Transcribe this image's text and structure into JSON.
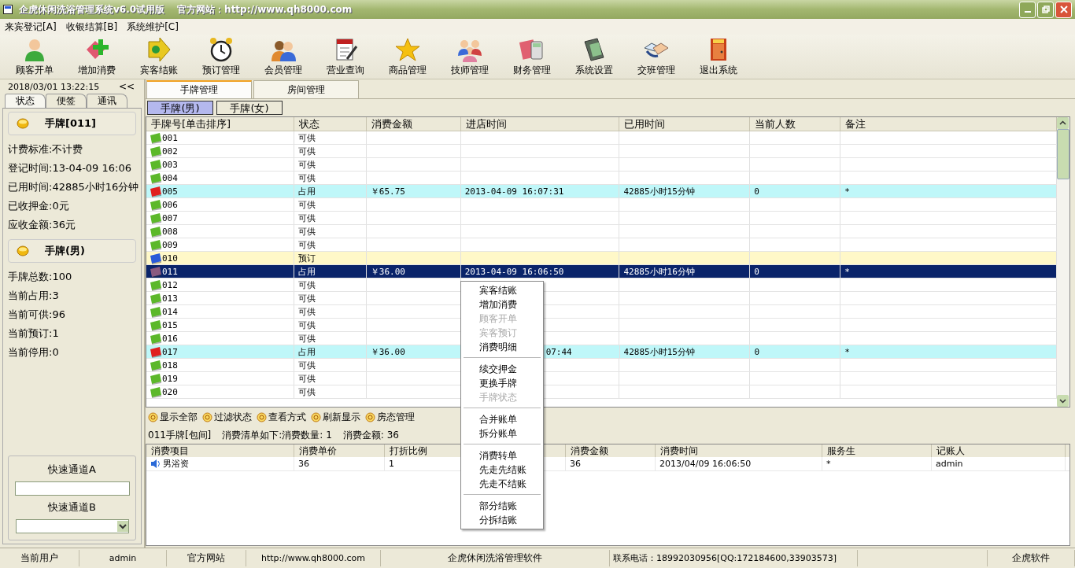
{
  "window": {
    "title": "企虎休闲洗浴管理系统v6.0试用版",
    "website_label": "官方网站：http://www.qh8000.com"
  },
  "menu_bar": [
    "来宾登记[A]",
    "收银结算[B]",
    "系统维护[C]"
  ],
  "toolbar": [
    "顾客开单",
    "增加消费",
    "宾客结账",
    "预订管理",
    "会员管理",
    "营业查询",
    "商品管理",
    "技师管理",
    "财务管理",
    "系统设置",
    "交班管理",
    "退出系统"
  ],
  "sidebar": {
    "datetime": "2018/03/01 13:22:15",
    "collapse": "<<",
    "tabs": [
      {
        "label": "状态",
        "selected": true
      },
      {
        "label": "便签",
        "selected": false
      },
      {
        "label": "通讯",
        "selected": false
      }
    ],
    "sections": [
      {
        "title": "手牌[011]",
        "lines": [
          "计费标准:不计费",
          "登记时间:13-04-09 16:06",
          "已用时间:42885小时16分钟",
          "已收押金:0元",
          "应收金额:36元"
        ]
      },
      {
        "title": "手牌(男)",
        "lines": [
          "手牌总数:100",
          "当前占用:3",
          "当前可供:96",
          "当前预订:1",
          "当前停用:0"
        ]
      }
    ],
    "quick_a": "快速通道A",
    "quick_b": "快速通道B"
  },
  "tabs": [
    {
      "label": "手牌管理",
      "selected": true
    },
    {
      "label": "房间管理",
      "selected": false
    }
  ],
  "sub_tabs": [
    {
      "label": "手牌(男)",
      "selected": true
    },
    {
      "label": "手牌(女)",
      "selected": false
    }
  ],
  "table": {
    "columns": [
      "手牌号[单击排序]",
      "状态",
      "消费金额",
      "进店时间",
      "已用时间",
      "当前人数",
      "备注"
    ],
    "rows": [
      {
        "no": "001",
        "status": "可供",
        "kind": "available",
        "selected": false
      },
      {
        "no": "002",
        "status": "可供",
        "kind": "available",
        "selected": false
      },
      {
        "no": "003",
        "status": "可供",
        "kind": "available",
        "selected": false
      },
      {
        "no": "004",
        "status": "可供",
        "kind": "available",
        "selected": false
      },
      {
        "no": "005",
        "status": "占用",
        "kind": "occupied",
        "selected": false,
        "amount": "￥65.75",
        "entry_time": "2013-04-09 16:07:31",
        "used_time": "42885小时15分钟",
        "people": "0",
        "note": "*"
      },
      {
        "no": "006",
        "status": "可供",
        "kind": "available",
        "selected": false
      },
      {
        "no": "007",
        "status": "可供",
        "kind": "available",
        "selected": false
      },
      {
        "no": "008",
        "status": "可供",
        "kind": "available",
        "selected": false
      },
      {
        "no": "009",
        "status": "可供",
        "kind": "available",
        "selected": false
      },
      {
        "no": "010",
        "status": "预订",
        "kind": "reserved",
        "selected": false
      },
      {
        "no": "011",
        "status": "占用",
        "kind": "occupied",
        "selected": true,
        "amount": "￥36.00",
        "entry_time": "2013-04-09 16:06:50",
        "used_time": "42885小时16分钟",
        "people": "0",
        "note": "*"
      },
      {
        "no": "012",
        "status": "可供",
        "kind": "available",
        "selected": false
      },
      {
        "no": "013",
        "status": "可供",
        "kind": "available",
        "selected": false
      },
      {
        "no": "014",
        "status": "可供",
        "kind": "available",
        "selected": false
      },
      {
        "no": "015",
        "status": "可供",
        "kind": "available",
        "selected": false
      },
      {
        "no": "016",
        "status": "可供",
        "kind": "available",
        "selected": false
      },
      {
        "no": "017",
        "status": "占用",
        "kind": "occupied",
        "selected": false,
        "amount": "￥36.00",
        "entry_time": "07:44",
        "entry_time_partly_hidden": true,
        "used_time": "42885小时15分钟",
        "people": "0",
        "note": "*"
      },
      {
        "no": "018",
        "status": "可供",
        "kind": "available",
        "selected": false
      },
      {
        "no": "019",
        "status": "可供",
        "kind": "available",
        "selected": false
      },
      {
        "no": "020",
        "status": "可供",
        "kind": "available",
        "selected": false
      }
    ]
  },
  "actions": [
    "显示全部",
    "过滤状态",
    "查看方式",
    "刷新显示",
    "房态管理"
  ],
  "summary": [
    "011手牌[包间]",
    "消费清单如下:消费数量: 1",
    "消费金额: 36"
  ],
  "detail": {
    "columns": [
      "消费项目",
      "消费单价",
      "打折比例",
      "",
      "消费金额",
      "消费时间",
      "服务生",
      "记账人"
    ],
    "rows": [
      [
        "男浴资",
        "36",
        "1",
        "",
        "36",
        "2013/04/09 16:06:50",
        "*",
        "admin"
      ]
    ]
  },
  "context_menu": [
    [
      {
        "label": "宾客结账",
        "disabled": false
      },
      {
        "label": "增加消费",
        "disabled": false
      },
      {
        "label": "顾客开单",
        "disabled": true
      },
      {
        "label": "宾客预订",
        "disabled": true
      },
      {
        "label": "消费明细",
        "disabled": false
      }
    ],
    [
      {
        "label": "续交押金",
        "disabled": false
      },
      {
        "label": "更换手牌",
        "disabled": false
      },
      {
        "label": "手牌状态",
        "disabled": true
      }
    ],
    [
      {
        "label": "合并账单",
        "disabled": false
      },
      {
        "label": "拆分账单",
        "disabled": false
      }
    ],
    [
      {
        "label": "消费转单",
        "disabled": false
      },
      {
        "label": "先走先结账",
        "disabled": false
      },
      {
        "label": "先走不结账",
        "disabled": false
      }
    ],
    [
      {
        "label": "部分结账",
        "disabled": false
      },
      {
        "label": "分拆结账",
        "disabled": false
      }
    ]
  ],
  "status_bar": [
    "当前用户",
    "admin",
    "官方网站",
    "http://www.qh8000.com",
    "企虎休闲洗浴管理软件",
    "联系电话：18992030956[QQ:172184600,33903573]",
    "企虎软件"
  ]
}
